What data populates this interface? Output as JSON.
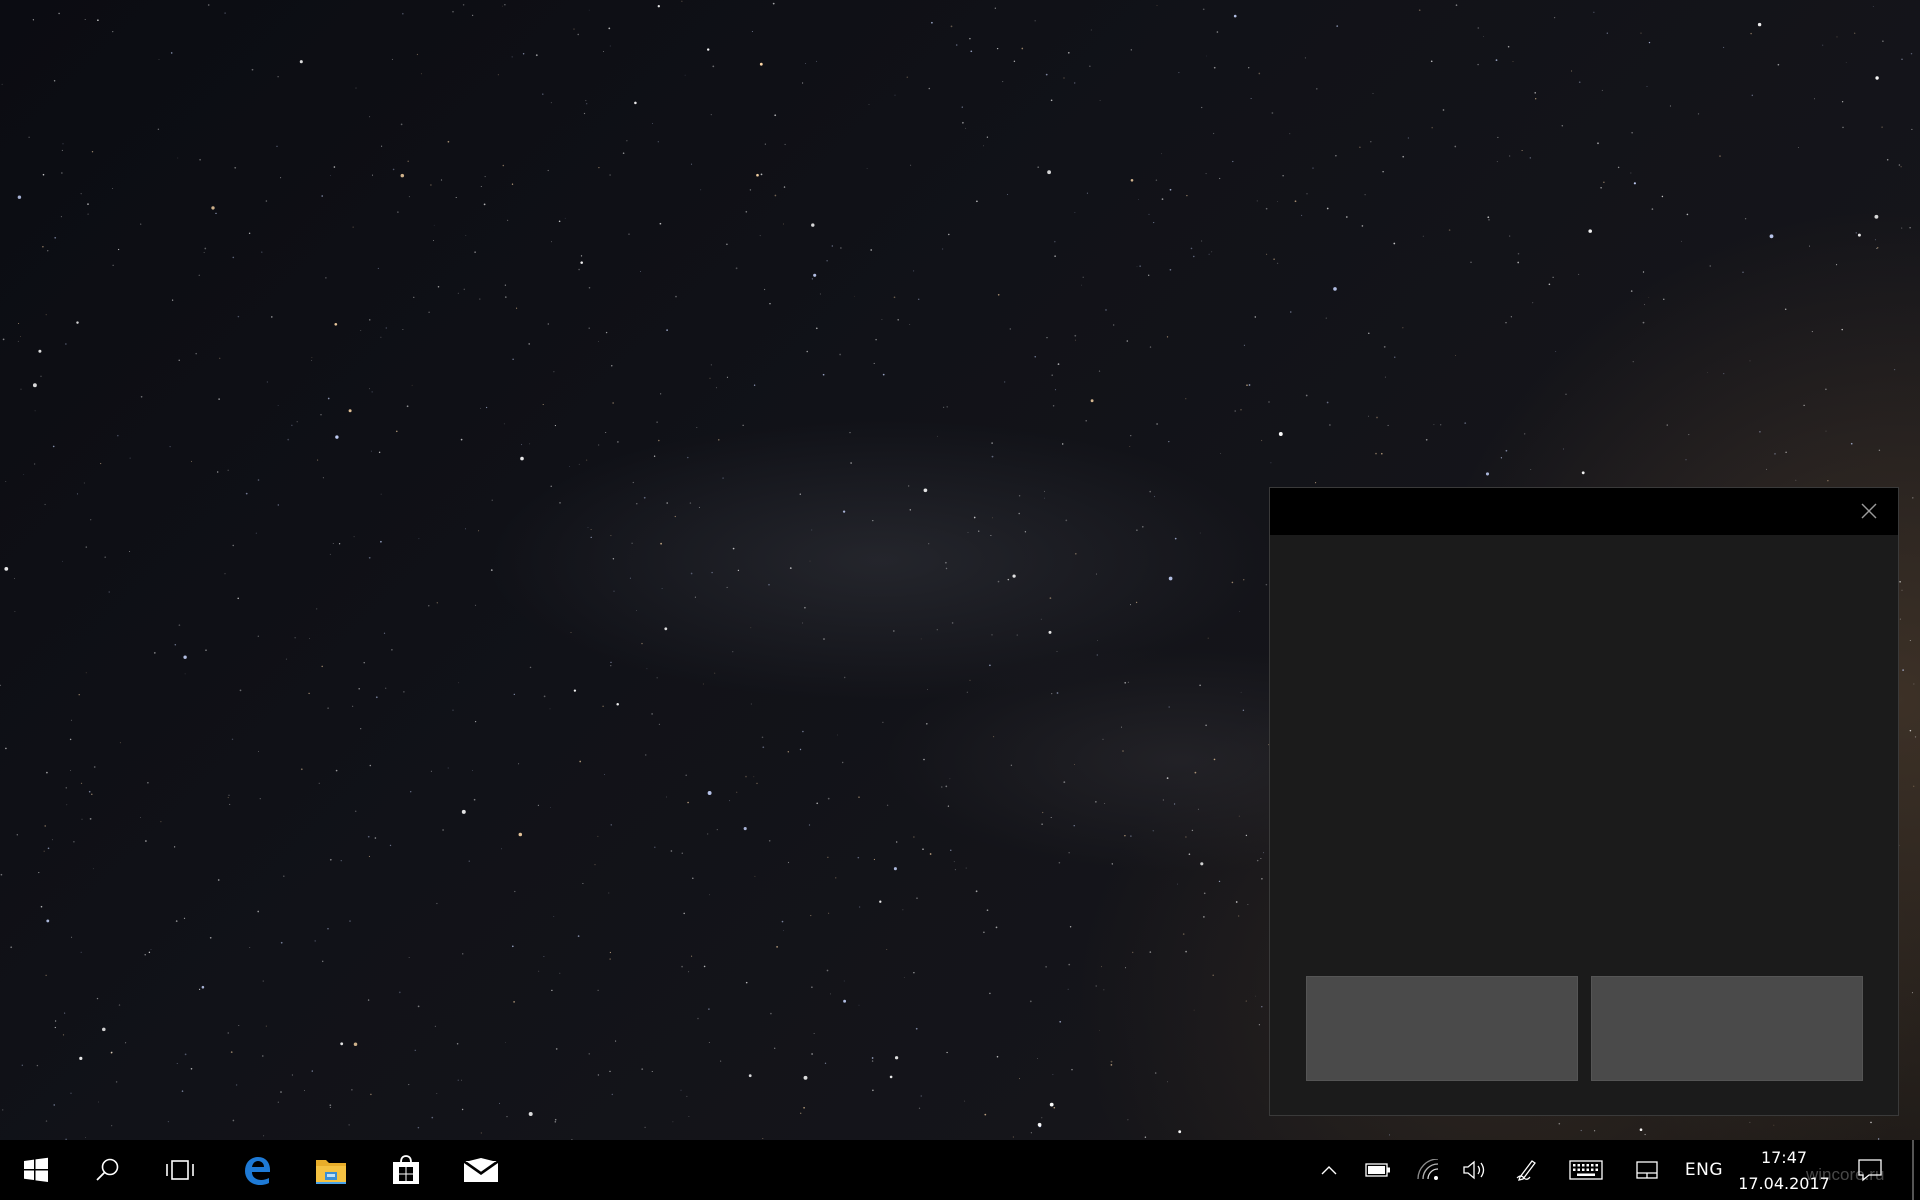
{
  "dialog": {
    "title": "",
    "close_icon": "close-icon",
    "left_button_label": "",
    "right_button_label": ""
  },
  "taskbar": {
    "start_icon": "windows-logo-icon",
    "search_icon": "search-icon",
    "task_view_icon": "task-view-icon",
    "pinned": [
      {
        "name": "edge",
        "icon": "edge-icon",
        "color": "#1e7ad6"
      },
      {
        "name": "file-explorer",
        "icon": "folder-icon",
        "color": "#f5c242"
      },
      {
        "name": "store",
        "icon": "store-icon",
        "color": "#ffffff"
      },
      {
        "name": "mail",
        "icon": "mail-icon",
        "color": "#ffffff"
      }
    ],
    "tray": {
      "show_hidden_icon": "chevron-up-icon",
      "battery_icon": "battery-icon",
      "network_icon": "wifi-icon",
      "volume_icon": "volume-icon",
      "pen_icon": "pen-workspace-icon",
      "keyboard_icon": "touch-keyboard-icon",
      "touchpad_icon": "touchpad-icon",
      "language": "ENG",
      "time": "17:47",
      "date": "17.04.2017",
      "action_center_icon": "action-center-icon"
    }
  },
  "watermark": "wincore.ru"
}
